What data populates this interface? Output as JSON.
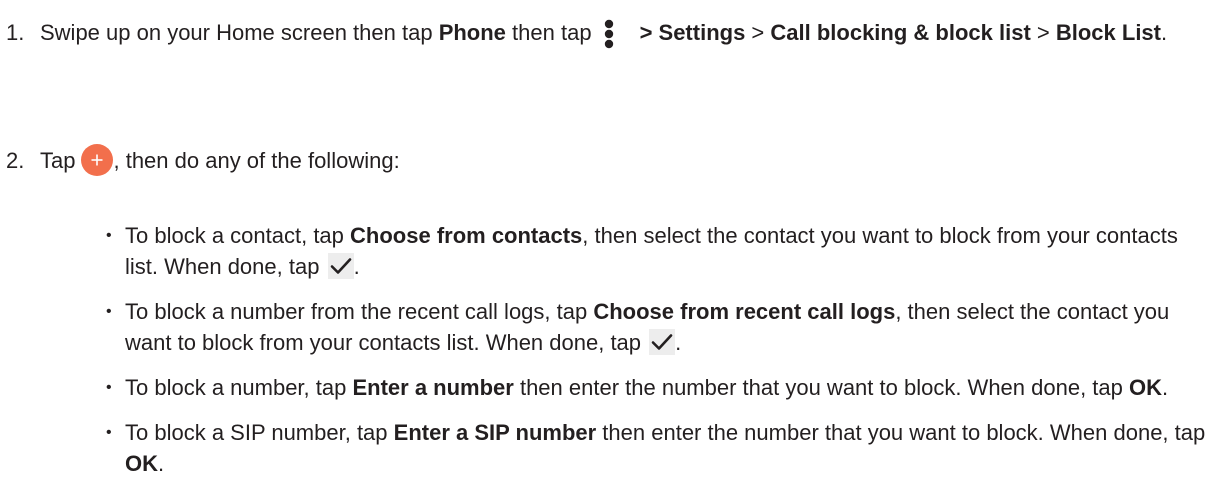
{
  "step1": {
    "number": "1.",
    "t1": "Swipe up on your Home screen then tap ",
    "phone": "Phone",
    "t2": " then tap",
    "settings": "> Settings",
    "sep1": " > ",
    "call_blocking": "Call blocking & block list",
    "sep2": " > ",
    "block_list": "Block List",
    "end": "."
  },
  "step2": {
    "number": "2.",
    "tap": "Tap",
    "after_icon": ", then do any of the following:"
  },
  "options": [
    {
      "pre": "To block a contact, tap ",
      "bold": "Choose from contacts",
      "post": ", then select the contact you want to block from your contacts list. When done, tap ",
      "end": "."
    },
    {
      "pre": "To block a number from the recent call logs, tap ",
      "bold": "Choose from recent call logs",
      "post": ", then select the contact you want to block from your contacts list. When done, tap ",
      "end": "."
    },
    {
      "pre": "To block a number, tap ",
      "bold": "Enter a number",
      "post": " then enter the number that you want to block. When done, tap ",
      "bold2": "OK",
      "end": "."
    },
    {
      "pre": "To block a SIP number, tap ",
      "bold": "Enter a SIP number",
      "post": " then enter the number that you want to block. When done, tap ",
      "bold2": "OK",
      "end": "."
    }
  ],
  "bullet_char": "•",
  "colors": {
    "text": "#231f20",
    "add_button": "#f26f4c",
    "check_bg": "#ededed"
  },
  "icons": {
    "more": "more-vertical-icon",
    "add": "add-circle-icon",
    "check": "checkmark-icon"
  }
}
